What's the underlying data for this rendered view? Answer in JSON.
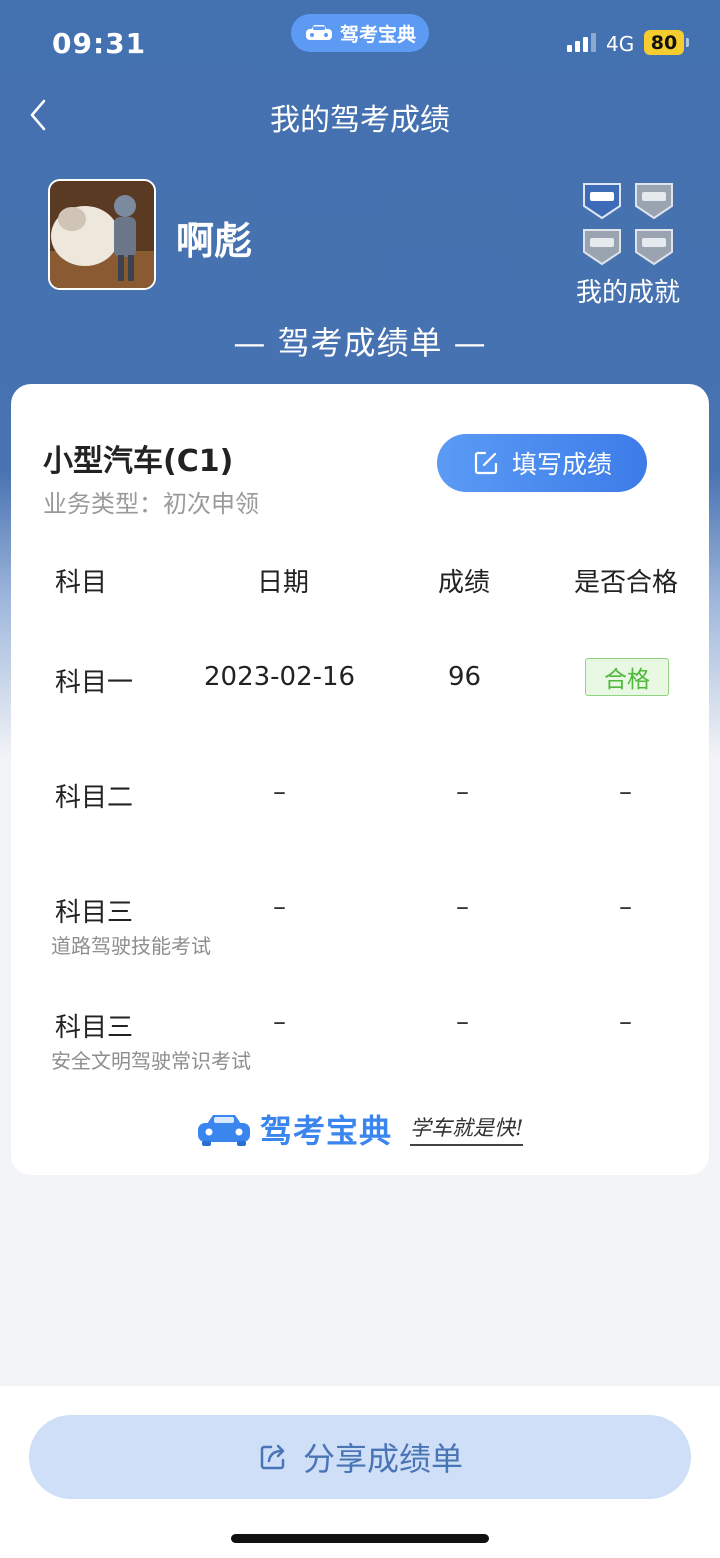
{
  "status": {
    "time": "09:31",
    "app_pill": "驾考宝典",
    "network": "4G",
    "battery": "80"
  },
  "nav": {
    "title": "我的驾考成绩"
  },
  "profile": {
    "username": "啊彪",
    "achievements_label": "我的成就"
  },
  "sheet_title": "— 驾考成绩单 —",
  "card": {
    "car_type": "小型汽车(C1)",
    "business_type": "业务类型：初次申领",
    "fill_button": "填写成绩",
    "headers": [
      "科目",
      "日期",
      "成绩",
      "是否合格"
    ],
    "rows": [
      {
        "subject": "科目一",
        "sub": "",
        "date": "2023-02-16",
        "score": "96",
        "status": "合格"
      },
      {
        "subject": "科目二",
        "sub": "",
        "date": "–",
        "score": "–",
        "status": "–"
      },
      {
        "subject": "科目三",
        "sub": "道路驾驶技能考试",
        "date": "–",
        "score": "–",
        "status": "–"
      },
      {
        "subject": "科目三",
        "sub": "安全文明驾驶常识考试",
        "date": "–",
        "score": "–",
        "status": "–"
      }
    ],
    "brand_name": "驾考宝典",
    "brand_slogan": "学车就是快!"
  },
  "share_button": "分享成绩单",
  "colors": {
    "header_blue": "#4471b0",
    "accent_blue": "#3d7ce8",
    "pass_green": "#4fb83d",
    "share_bg": "#cfdff8"
  }
}
